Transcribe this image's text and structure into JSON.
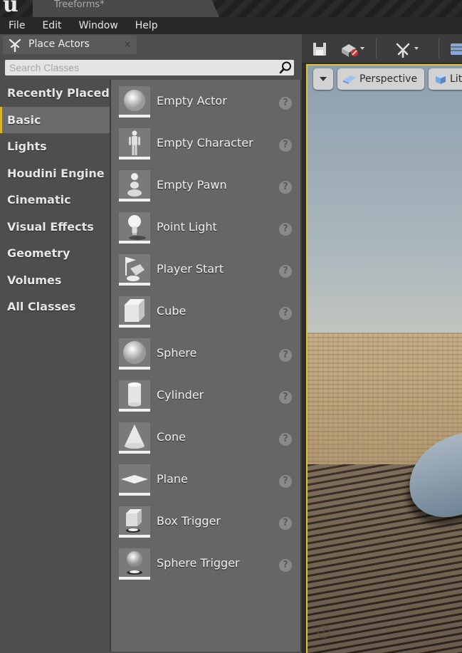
{
  "window": {
    "logo_text": "u",
    "document_tab": "Treeforms*"
  },
  "menu": {
    "items": [
      "File",
      "Edit",
      "Window",
      "Help"
    ]
  },
  "place_actors": {
    "tab_label": "Place Actors",
    "close_glyph": "×",
    "search_placeholder": "Search Classes",
    "categories": [
      {
        "label": "Recently Placed",
        "selected": false
      },
      {
        "label": "Basic",
        "selected": true
      },
      {
        "label": "Lights",
        "selected": false
      },
      {
        "label": "Houdini Engine",
        "selected": false
      },
      {
        "label": "Cinematic",
        "selected": false
      },
      {
        "label": "Visual Effects",
        "selected": false
      },
      {
        "label": "Geometry",
        "selected": false
      },
      {
        "label": "Volumes",
        "selected": false
      },
      {
        "label": "All Classes",
        "selected": false
      }
    ],
    "items": [
      {
        "label": "Empty Actor",
        "icon": "sphere-icon"
      },
      {
        "label": "Empty Character",
        "icon": "character-icon"
      },
      {
        "label": "Empty Pawn",
        "icon": "pawn-icon"
      },
      {
        "label": "Point Light",
        "icon": "lightbulb-icon"
      },
      {
        "label": "Player Start",
        "icon": "player-start-icon"
      },
      {
        "label": "Cube",
        "icon": "cube-icon"
      },
      {
        "label": "Sphere",
        "icon": "sphere-icon"
      },
      {
        "label": "Cylinder",
        "icon": "cylinder-icon"
      },
      {
        "label": "Cone",
        "icon": "cone-icon"
      },
      {
        "label": "Plane",
        "icon": "plane-icon"
      },
      {
        "label": "Box Trigger",
        "icon": "box-trigger-icon"
      },
      {
        "label": "Sphere Trigger",
        "icon": "sphere-trigger-icon"
      }
    ],
    "help_glyph": "?"
  },
  "viewport": {
    "perspective_label": "Perspective",
    "lit_label": "Lit",
    "help_glyph": "?"
  },
  "colors": {
    "accent_yellow": "#e6c230",
    "panel_bg": "#4e4e4e",
    "list_bg": "#666666"
  }
}
